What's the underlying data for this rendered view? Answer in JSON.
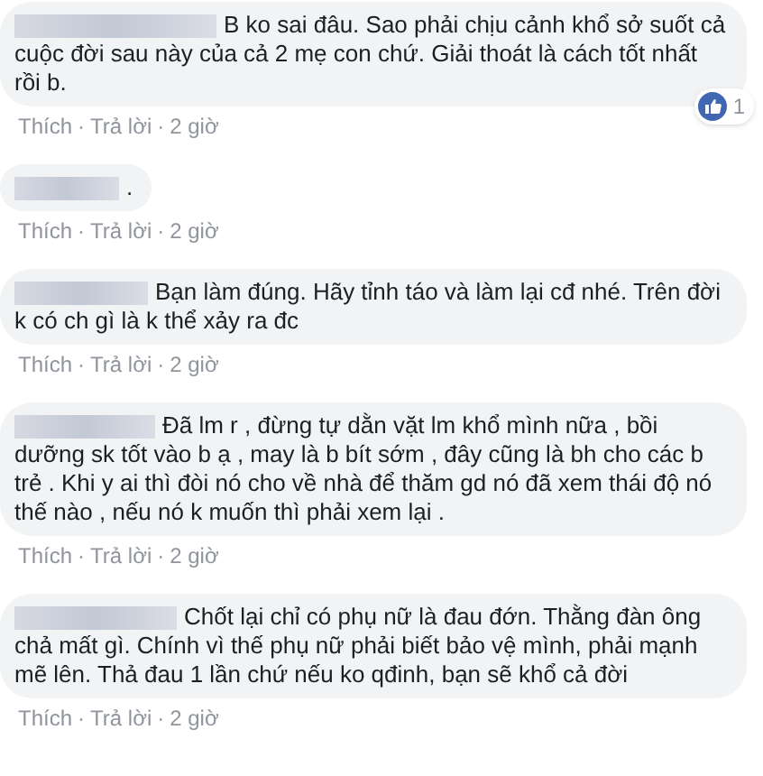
{
  "comments": [
    {
      "text": "B ko sai đâu. Sao phải chịu cảnh khổ sở suốt cả cuộc đời sau này của cả 2 mẹ con chứ. Giải thoát là cách tốt nhất rồi b.",
      "reaction_count": "1",
      "footer": [
        {
          "kind": "link",
          "text": "Thích"
        },
        {
          "kind": "sep",
          "text": "·"
        },
        {
          "kind": "link",
          "text": "Trả lời"
        },
        {
          "kind": "sep",
          "text": "·"
        },
        {
          "kind": "time",
          "text": "2 giờ"
        }
      ]
    },
    {
      "text": ".",
      "footer": [
        {
          "kind": "link",
          "text": "Thích"
        },
        {
          "kind": "sep",
          "text": "·"
        },
        {
          "kind": "link",
          "text": "Trả lời"
        },
        {
          "kind": "sep",
          "text": "·"
        },
        {
          "kind": "time",
          "text": "2 giờ"
        }
      ]
    },
    {
      "text": "Bạn làm đúng. Hãy tỉnh táo và làm lại cđ nhé. Trên đời k có ch gì là k thể xảy ra đc",
      "footer": [
        {
          "kind": "link",
          "text": "Thích"
        },
        {
          "kind": "sep",
          "text": "·"
        },
        {
          "kind": "link",
          "text": "Trả lời"
        },
        {
          "kind": "sep",
          "text": "·"
        },
        {
          "kind": "time",
          "text": "2 giờ"
        }
      ]
    },
    {
      "text": "Đã lm r , đừng tự dằn vặt lm khổ mình nữa , bồi dưỡng sk tốt vào b ạ , may là b bít sớm , đây cũng là bh cho các b trẻ . Khi y ai thì đòi nó cho về nhà để thăm gd nó đã xem thái độ nó thế nào , nếu nó k muốn thì phải xem lại .",
      "footer": [
        {
          "kind": "link",
          "text": "Thích"
        },
        {
          "kind": "sep",
          "text": "·"
        },
        {
          "kind": "link",
          "text": "Trả lời"
        },
        {
          "kind": "sep",
          "text": "·"
        },
        {
          "kind": "time",
          "text": "2 giờ"
        }
      ]
    },
    {
      "text": "Chốt lại chỉ có phụ nữ là đau đớn. Thằng đàn ông chả mất gì. Chính vì thế phụ nữ phải biết bảo vệ mình, phải mạnh mẽ lên. Thả đau 1 lần chứ nếu ko qđinh, bạn sẽ khổ cả đời",
      "footer": [
        {
          "kind": "link",
          "text": "Thích"
        },
        {
          "kind": "sep",
          "text": "·"
        },
        {
          "kind": "link",
          "text": "Trả lời"
        },
        {
          "kind": "sep",
          "text": "·"
        },
        {
          "kind": "time",
          "text": "2 giờ"
        }
      ]
    }
  ]
}
